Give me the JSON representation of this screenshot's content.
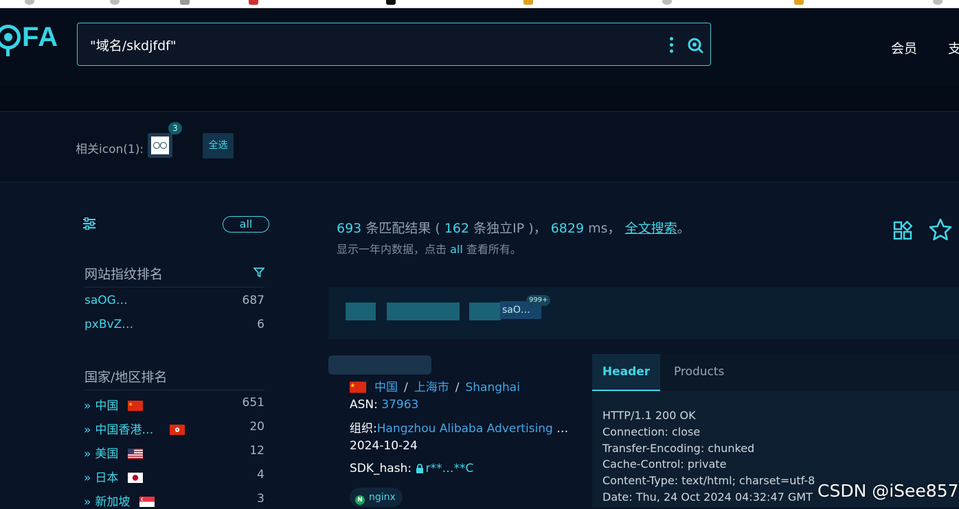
{
  "header": {
    "logo": "FA",
    "search_query": "\"域名/skdjfdf\"",
    "nav_member": "会员",
    "nav_more": "支"
  },
  "icon_bar": {
    "label": "相关icon(1):",
    "badge": "3",
    "select_all": "全选"
  },
  "sidebar": {
    "all_label": "all",
    "fingerprint_title": "网站指纹排名",
    "fingerprints": [
      {
        "name": "saOG…",
        "count": "687"
      },
      {
        "name": "pxBvZ…",
        "count": "6"
      }
    ],
    "country_title": "国家/地区排名",
    "countries": [
      {
        "name": "中国",
        "count": "651",
        "flag": "cn"
      },
      {
        "name": "中国香港…",
        "count": "20",
        "flag": "hk"
      },
      {
        "name": "美国",
        "count": "12",
        "flag": "us"
      },
      {
        "name": "日本",
        "count": "4",
        "flag": "jp"
      },
      {
        "name": "新加坡",
        "count": "3",
        "flag": "sg"
      }
    ]
  },
  "results": {
    "total": "693",
    "total_label": "条匹配结果 (",
    "unique_ip": "162",
    "unique_ip_label": "条独立IP )，",
    "time": "6829",
    "time_label": "ms，",
    "fulltext": "全文搜索",
    "period": "。",
    "sub_prefix": "显示一年内数据，点击",
    "sub_all": "all",
    "sub_suffix": "查看所有。",
    "tag_text": "saO…",
    "tag_badge": "999+"
  },
  "result_item": {
    "country": "中国",
    "province": "上海市",
    "city": "Shanghai",
    "sep": "/",
    "asn_label": "ASN:",
    "asn": "37963",
    "org_label": "组织:",
    "org": "Hangzhou Alibaba Advertising C…",
    "date": "2024-10-24",
    "sdk_label": "SDK_hash:",
    "sdk_value": "r**…**C",
    "server": "nginx"
  },
  "detail_tabs": {
    "header": "Header",
    "products": "Products"
  },
  "http_header": [
    "HTTP/1.1 200 OK",
    "Connection: close",
    "Transfer-Encoding: chunked",
    "Cache-Control: private",
    "Content-Type: text/html; charset=utf-8",
    "Date: Thu, 24 Oct 2024 04:32:47 GMT"
  ],
  "watermark": "CSDN @iSee857",
  "colors": {
    "accent": "#3fd8e8",
    "link": "#3fa8e8",
    "background": "#091426"
  }
}
